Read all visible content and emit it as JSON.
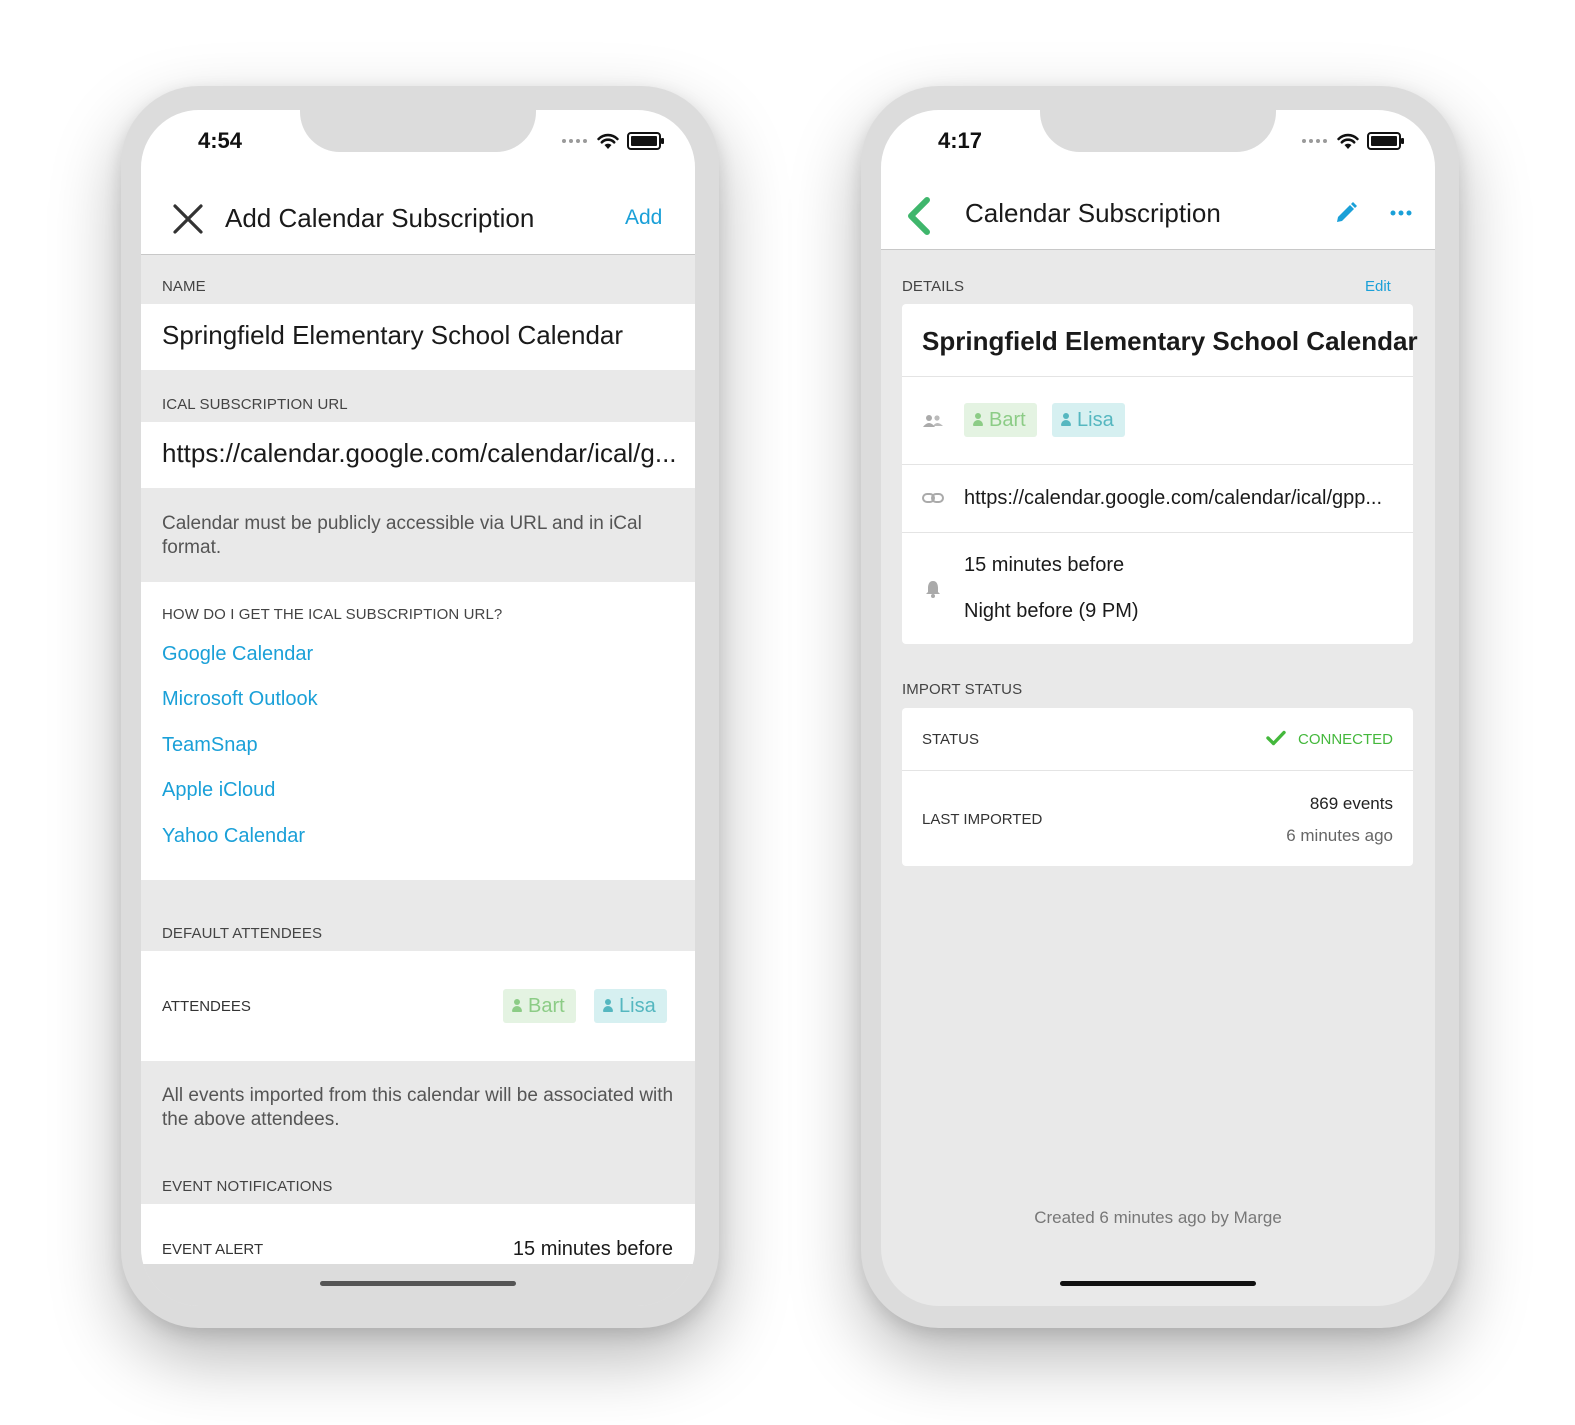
{
  "left": {
    "status_time": "4:54",
    "nav": {
      "title": "Add Calendar Subscription",
      "action": "Add"
    },
    "name_section": {
      "header": "NAME",
      "value": "Springfield Elementary School Calendar"
    },
    "url_section": {
      "header": "ICAL SUBSCRIPTION URL",
      "value": "https://calendar.google.com/calendar/ical/g...",
      "note": "Calendar must be publicly accessible via URL and in iCal format."
    },
    "howto": {
      "header": "HOW DO I GET THE ICAL SUBSCRIPTION URL?",
      "links": [
        "Google Calendar",
        "Microsoft Outlook",
        "TeamSnap",
        "Apple iCloud",
        "Yahoo Calendar"
      ]
    },
    "attendees_section": {
      "header": "DEFAULT ATTENDEES",
      "row_label": "ATTENDEES",
      "chips": [
        "Bart",
        "Lisa"
      ],
      "note": "All events imported from this calendar will be associated with the above attendees."
    },
    "notifications": {
      "header": "EVENT NOTIFICATIONS",
      "row_label": "EVENT ALERT",
      "row_value": "15 minutes before"
    }
  },
  "right": {
    "status_time": "4:17",
    "nav": {
      "title": "Calendar Subscription"
    },
    "details": {
      "header": "DETAILS",
      "edit": "Edit",
      "title": "Springfield Elementary School Calendar",
      "chips": [
        "Bart",
        "Lisa"
      ],
      "url": "https://calendar.google.com/calendar/ical/gpp...",
      "alerts": [
        "15 minutes before",
        "Night before (9 PM)"
      ]
    },
    "import": {
      "header": "IMPORT STATUS",
      "status_label": "STATUS",
      "status_value": "CONNECTED",
      "last_label": "LAST IMPORTED",
      "last_events": "869 events",
      "last_time": "6 minutes ago"
    },
    "footer": "Created 6 minutes ago by Marge"
  },
  "colors": {
    "link": "#1aa0d8",
    "back_green": "#3fb66c",
    "connected_green": "#44b83c",
    "bart_bg": "#e4f3e2",
    "lisa_bg": "#d6f0f1"
  }
}
